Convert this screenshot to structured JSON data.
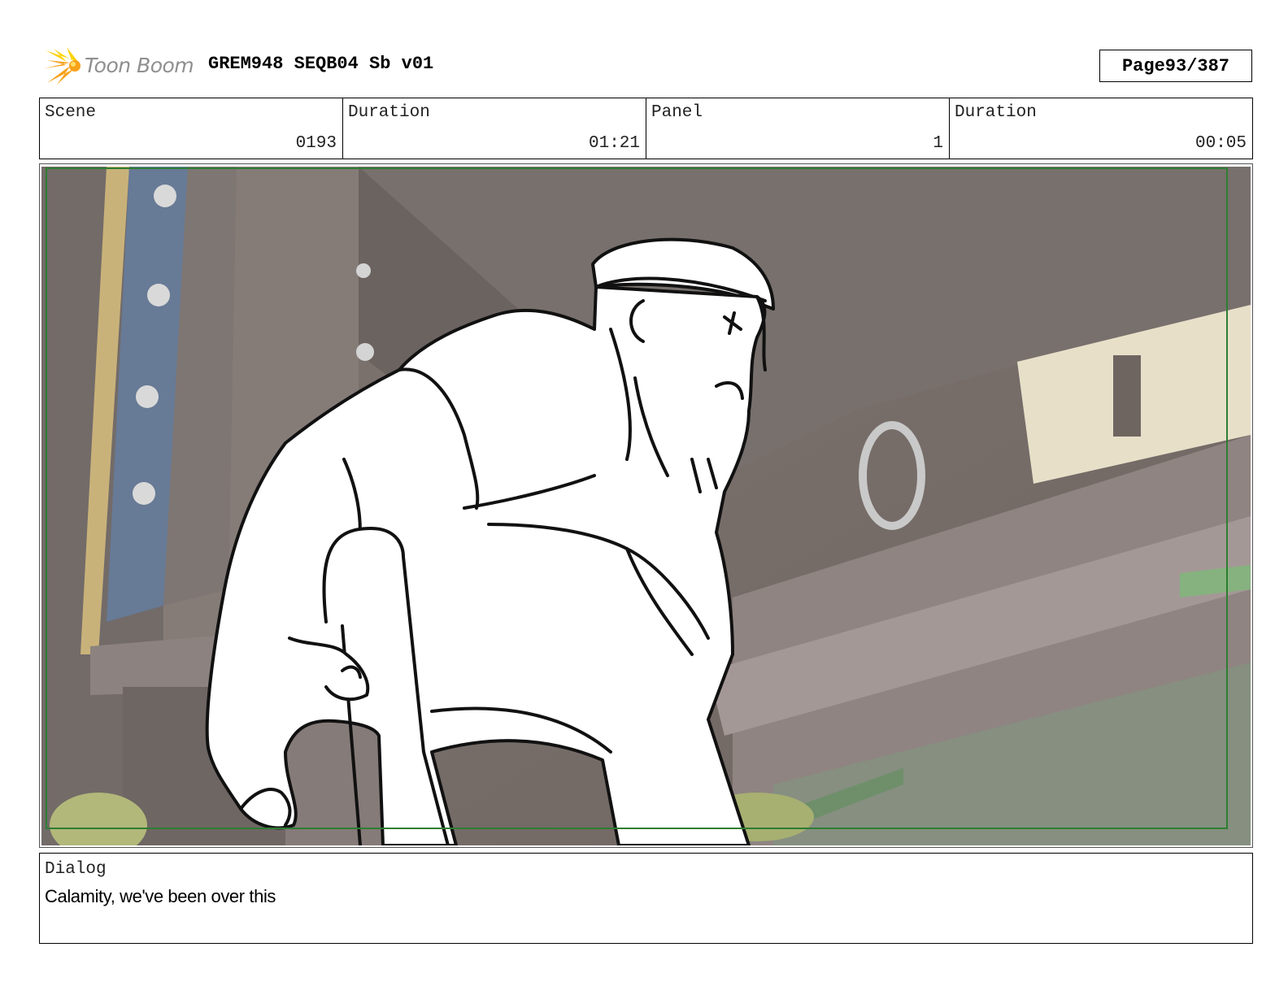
{
  "header": {
    "logo_text": "Toon Boom",
    "logo_icon": "starburst-logo-icon",
    "doc_title": "GREM948 SEQB04 Sb v01",
    "page_label": "Page",
    "page_value": "93/387"
  },
  "info": {
    "scene_label": "Scene",
    "scene_value": "0193",
    "scene_duration_label": "Duration",
    "scene_duration_value": "01:21",
    "panel_label": "Panel",
    "panel_value": "1",
    "panel_duration_label": "Duration",
    "panel_duration_value": "00:05"
  },
  "frame": {
    "illustration": "storyboard-sketch-over-3d-background",
    "safe_frame_color": "#2e7d32"
  },
  "dialog": {
    "label": "Dialog",
    "text": "Calamity, we've been over this"
  },
  "colors": {
    "logo_orange": "#f7a21b",
    "logo_yellow": "#ffd200",
    "logo_text": "#8f8f8f"
  }
}
